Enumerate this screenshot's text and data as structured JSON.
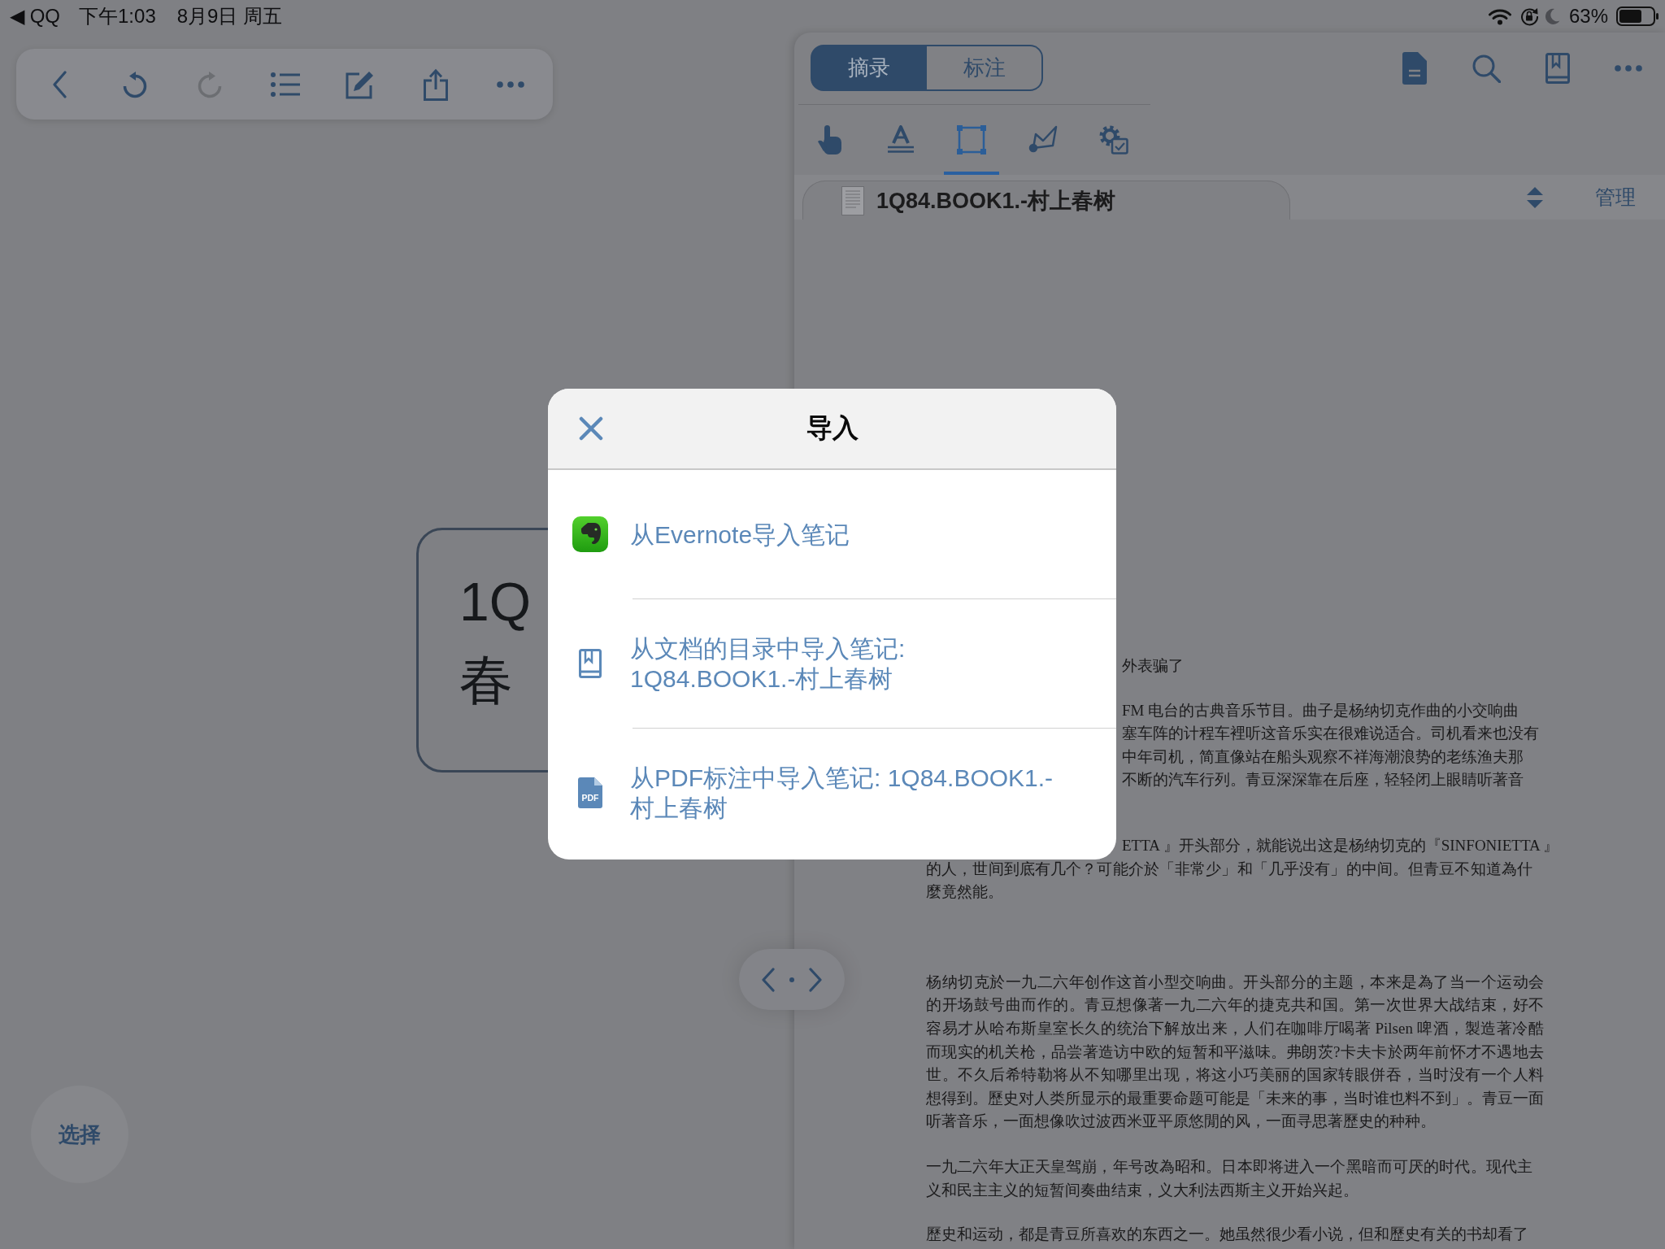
{
  "status_bar": {
    "back_app": "◀ QQ",
    "time": "下午1:03",
    "date": "8月9日 周五",
    "battery": "63%"
  },
  "mindmap_toolbar": [
    {
      "kind": "back",
      "disabled": false
    },
    {
      "kind": "undo",
      "disabled": false
    },
    {
      "kind": "redo",
      "disabled": true
    },
    {
      "kind": "outline",
      "disabled": false
    },
    {
      "kind": "edit",
      "disabled": false
    },
    {
      "kind": "share",
      "disabled": false
    },
    {
      "kind": "more",
      "disabled": false
    }
  ],
  "mindmap": {
    "node": {
      "lines": [
        "1Q",
        "春"
      ]
    },
    "select_button": "选择"
  },
  "reader": {
    "segments": [
      {
        "label": "摘录",
        "selected": true
      },
      {
        "label": "标注",
        "selected": false
      }
    ],
    "tools": [
      {
        "kind": "pointer",
        "selected": false
      },
      {
        "kind": "text",
        "selected": false
      },
      {
        "kind": "area",
        "selected": true
      },
      {
        "kind": "pen",
        "selected": false
      },
      {
        "kind": "settings",
        "selected": false
      }
    ],
    "tab": {
      "title": "1Q84.BOOK1.-村上春树"
    },
    "manage_button": "管理",
    "paragraphs": [
      {
        "covered_lines": [
          "外表骗了"
        ]
      },
      {
        "covered_lines": [
          "FM 电台的古典音乐节目。曲子是杨纳切克作曲的小交响曲",
          "塞车阵的计程车裡听这音乐实在很难说适合。司机看来也没有",
          "中年司机，简直像站在船头观察不祥海潮浪势的老练渔夫那",
          "不断的汽车行列。青豆深深靠在后座，轻轻闭上眼睛听著音"
        ]
      },
      {
        "covered_lines": [
          "ETTA 』开头部分，就能说出这是杨纳切克的『SINFONIETTA 』"
        ],
        "lines": [
          "的人，世间到底有几个？可能介於「非常少」和「几乎没有」的中间。但青豆不知道為什",
          "麼竟然能。"
        ]
      },
      {
        "lines": [
          "杨纳切克於一九二六年创作这首小型交响曲。开头部分的主题，本来是為了当一个运动会",
          "的开场鼓号曲而作的。青豆想像著一九二六年的捷克共和国。第一次世界大战结束，好不",
          "容易才从哈布斯皇室长久的统治下解放出来，人们在咖啡厅喝著 Pilsen 啤酒，製造著冷酷",
          "而现实的机关枪，品尝著造访中欧的短暂和平滋味。弗朗茨?卡夫卡於两年前怀才不遇地去",
          "世。不久后希特勒将从不知哪里出现，将这小巧美丽的国家转眼併吞，当时没有一个人料",
          "想得到。歷史对人类所显示的最重要命题可能是「未来的事，当时谁也料不到」。青豆一面",
          "听著音乐，一面想像吹过波西米亚平原悠閒的风，一面寻思著歷史的种种。"
        ]
      },
      {
        "lines": [
          "一九二六年大正天皇驾崩，年号改為昭和。日本即将进入一个黑暗而可厌的时代。现代主",
          "义和民主主义的短暂间奏曲结束，义大利法西斯主义开始兴起。"
        ]
      },
      {
        "lines": [
          "歷史和运动，都是青豆所喜欢的东西之一。她虽然很少看小说，但和歷史有关的书却看了"
        ]
      }
    ]
  },
  "dialog": {
    "title": "导入",
    "options": [
      {
        "kind": "evernote",
        "lines": [
          "从Evernote导入笔记"
        ]
      },
      {
        "kind": "outline",
        "lines": [
          "从文档的目录中导入笔记:",
          "1Q84.BOOK1.-村上春树"
        ]
      },
      {
        "kind": "pdf",
        "badge": "PDF",
        "lines": [
          "从PDF标注中导入笔记: 1Q84.BOOK1.-",
          "村上春树"
        ]
      }
    ]
  }
}
